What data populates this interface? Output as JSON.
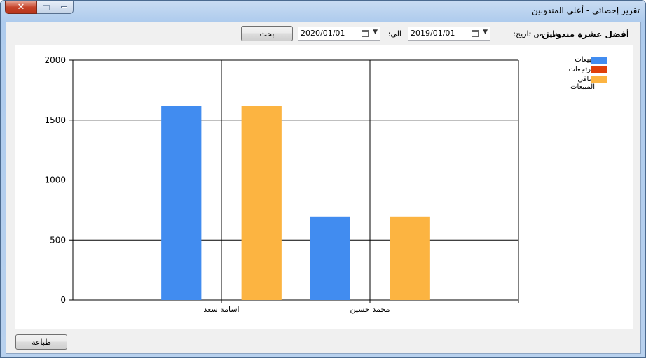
{
  "window": {
    "title": "تقرير إحصائي - أعلى المندوبين",
    "close_glyph": "✕"
  },
  "filters": {
    "title": "أفضل عشرة مندوبين",
    "from_label": "بداية من تاريخ:",
    "from_value": "2019/01/01",
    "to_label": "الى:",
    "to_value": "2020/01/01",
    "search_label": "بحث"
  },
  "footer": {
    "print_label": "طباعة"
  },
  "chart_data": {
    "type": "bar",
    "categories": [
      "اسامة سعد",
      "محمد حسين"
    ],
    "series": [
      {
        "name": "مبيعات",
        "values": [
          1620,
          695
        ],
        "color": "#418cf0"
      },
      {
        "name": "مرتجعات",
        "values": [
          0,
          0
        ],
        "color": "#e0400a"
      },
      {
        "name": "صافي المبيعات",
        "values": [
          1620,
          695
        ],
        "color": "#fcb441"
      }
    ],
    "ylim": [
      0,
      2000
    ],
    "yticks": [
      0,
      500,
      1000,
      1500,
      2000
    ],
    "grid": true,
    "legend": "top-right",
    "title": "",
    "xlabel": "",
    "ylabel": ""
  }
}
